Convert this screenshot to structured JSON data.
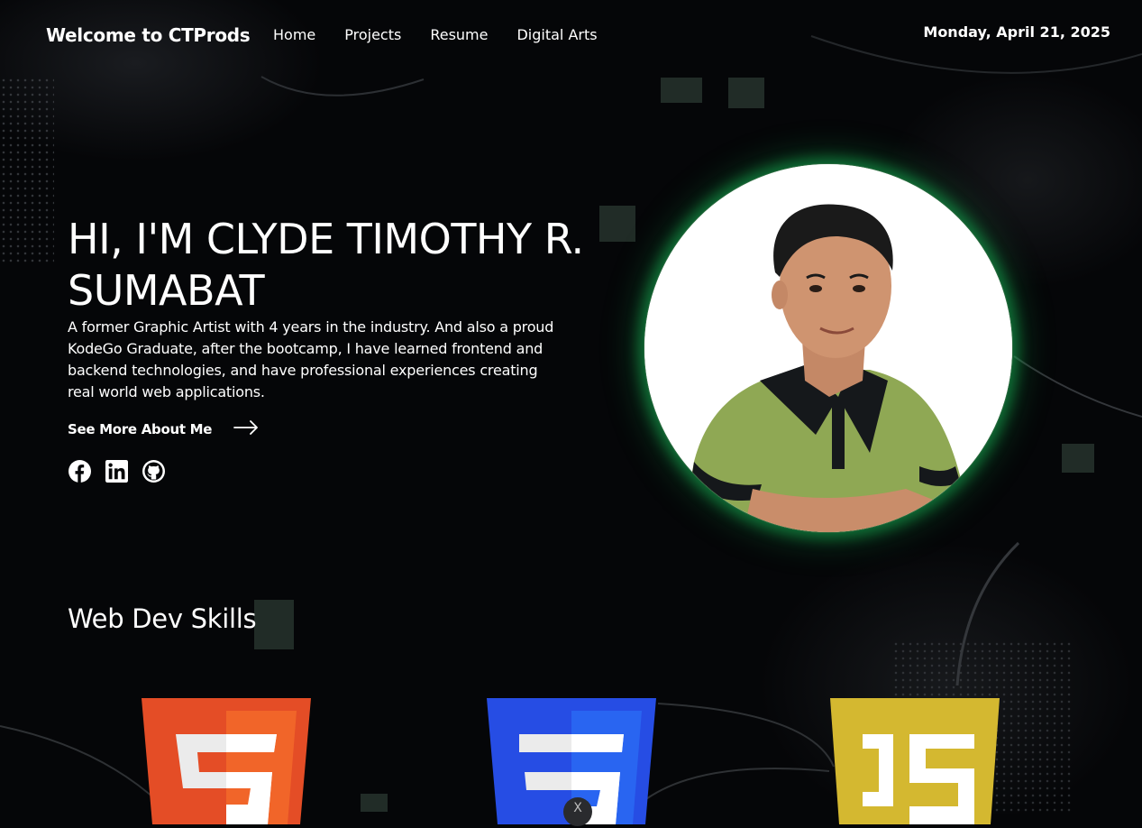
{
  "header": {
    "brand": "Welcome to CTProds",
    "nav": [
      "Home",
      "Projects",
      "Resume",
      "Digital Arts"
    ],
    "date": "Monday, April 21, 2025"
  },
  "hero": {
    "title": "HI, I'M CLYDE TIMOTHY R. SUMABAT",
    "description": "A former Graphic Artist with 4 years in the industry. And also a proud KodeGo Graduate, after the bootcamp, I have learned frontend and backend technologies, and have professional experiences creating real world web applications.",
    "cta": "See More About Me",
    "socials": [
      "facebook-icon",
      "linkedin-icon",
      "github-icon"
    ]
  },
  "skills": {
    "title": "Web Dev Skills",
    "items": [
      "html5-icon",
      "css3-icon",
      "javascript-icon"
    ]
  },
  "colors": {
    "background": "#050608",
    "glow": "#16aa50",
    "html5": "#e44d26",
    "css3": "#264de4",
    "js": "#d4b830"
  },
  "badge": "X"
}
